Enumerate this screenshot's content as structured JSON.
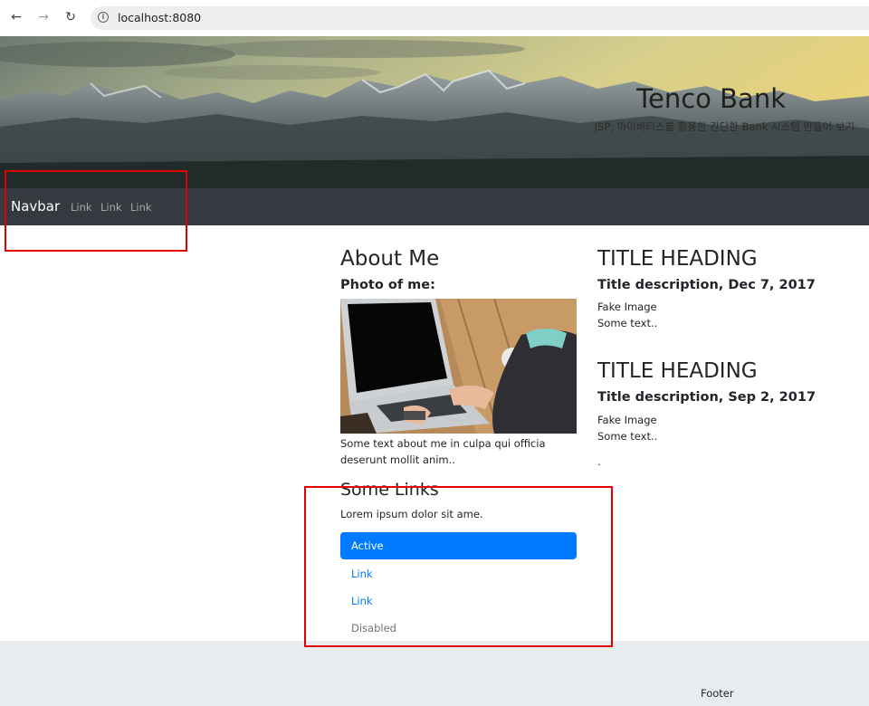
{
  "browser": {
    "url": "localhost:8080",
    "back_icon": "arrow-left-icon",
    "forward_icon": "arrow-right-icon",
    "reload_icon": "reload-icon",
    "info_icon": "info-icon"
  },
  "header": {
    "title": "Tenco Bank",
    "subtitle": "JSP, 마이바티스를 활용한 간단한 Bank 시스템 만들어 보기"
  },
  "navbar": {
    "brand": "Navbar",
    "links": [
      "Link",
      "Link",
      "Link"
    ]
  },
  "about": {
    "heading": "About Me",
    "photo_label": "Photo of me:",
    "text": "Some text about me in culpa qui officia deserunt mollit anim.."
  },
  "links_section": {
    "heading": "Some Links",
    "lorem": "Lorem ipsum dolor sit ame.",
    "items": [
      {
        "label": "Active"
      },
      {
        "label": "Link"
      },
      {
        "label": "Link"
      },
      {
        "label": "Disabled"
      }
    ]
  },
  "posts": [
    {
      "heading": "TITLE HEADING",
      "description": "Title description, Dec 7, 2017",
      "image_text": "Fake Image",
      "text": "Some text.."
    },
    {
      "heading": "TITLE HEADING",
      "description": "Title description, Sep 2, 2017",
      "image_text": "Fake Image",
      "text": "Some text.."
    }
  ],
  "posts_trailer": ".",
  "footer": {
    "text": "Footer"
  },
  "colors": {
    "navbar_bg": "#343a40",
    "primary": "#007bff",
    "footer_bg": "#e9ecef",
    "annotation_red": "#e00000"
  }
}
